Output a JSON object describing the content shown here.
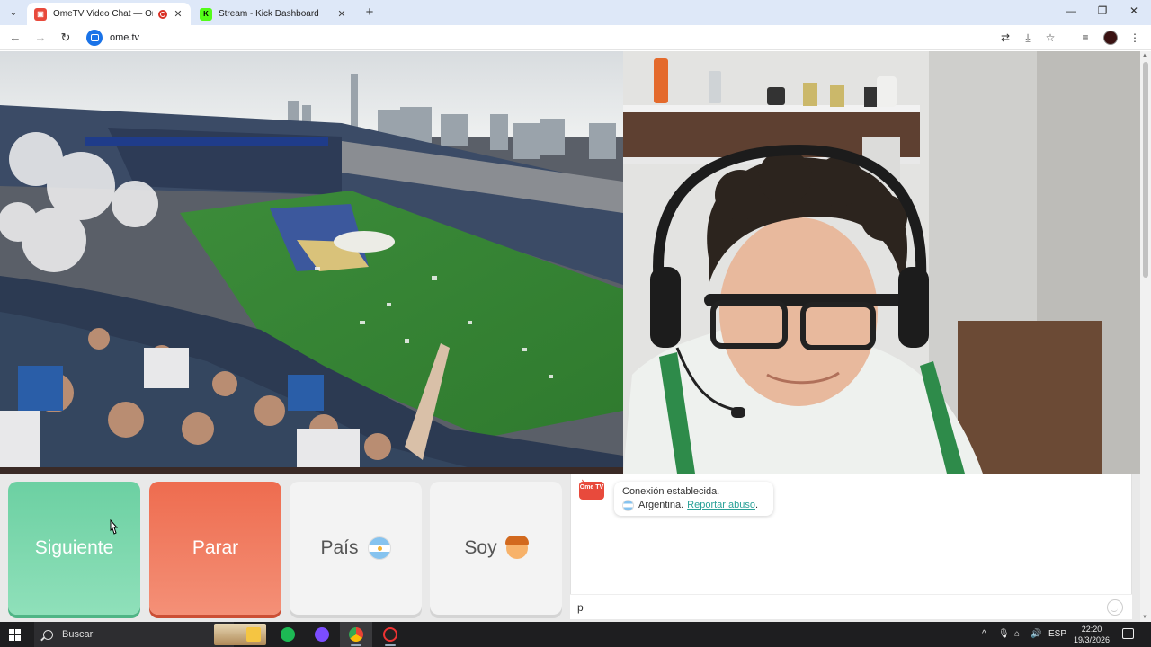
{
  "browser": {
    "tabs": [
      {
        "title": "OmeTV Video Chat — Ome",
        "favicon": "ometv-icon",
        "active": true,
        "recording": true
      },
      {
        "title": "Stream - Kick Dashboard",
        "favicon": "kick-icon",
        "active": false
      }
    ],
    "new_tab_label": "+",
    "address": "ome.tv"
  },
  "buttons": {
    "next_label": "Siguiente",
    "stop_label": "Parar",
    "country_label": "País",
    "gender_label": "Soy"
  },
  "chat": {
    "logo_text": "Ome TV",
    "status_message": "Conexión establecida.",
    "country": "Argentina.",
    "report_link": "Reportar abuso",
    "report_suffix": ".",
    "input_value": "p"
  },
  "taskbar": {
    "search_placeholder": "Buscar",
    "language": "ESP",
    "time": "22:20",
    "date": "19/3/2026"
  },
  "colors": {
    "next_button": "#6cd0a2",
    "stop_button": "#ee6c4f",
    "link": "#2aa198",
    "tab_strip": "#dee8f8"
  }
}
